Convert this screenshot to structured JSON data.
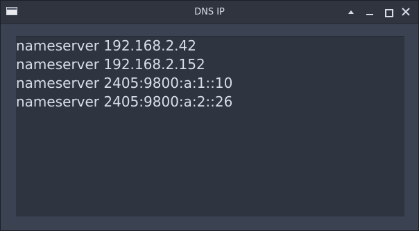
{
  "window": {
    "title": "DNS IP",
    "controls": {
      "shade": "chevron-up-icon",
      "minimize": "minimize-icon",
      "maximize": "maximize-icon",
      "close": "close-icon"
    }
  },
  "content": {
    "lines": [
      "nameserver 192.168.2.42",
      "nameserver 192.168.2.152",
      "nameserver 2405:9800:a:1::10",
      "nameserver 2405:9800:a:2::26"
    ]
  },
  "colors": {
    "titlebar": "#2f343f",
    "window_bg": "#3b4252",
    "content_bg": "#2e3440",
    "text": "#d8dee9"
  }
}
